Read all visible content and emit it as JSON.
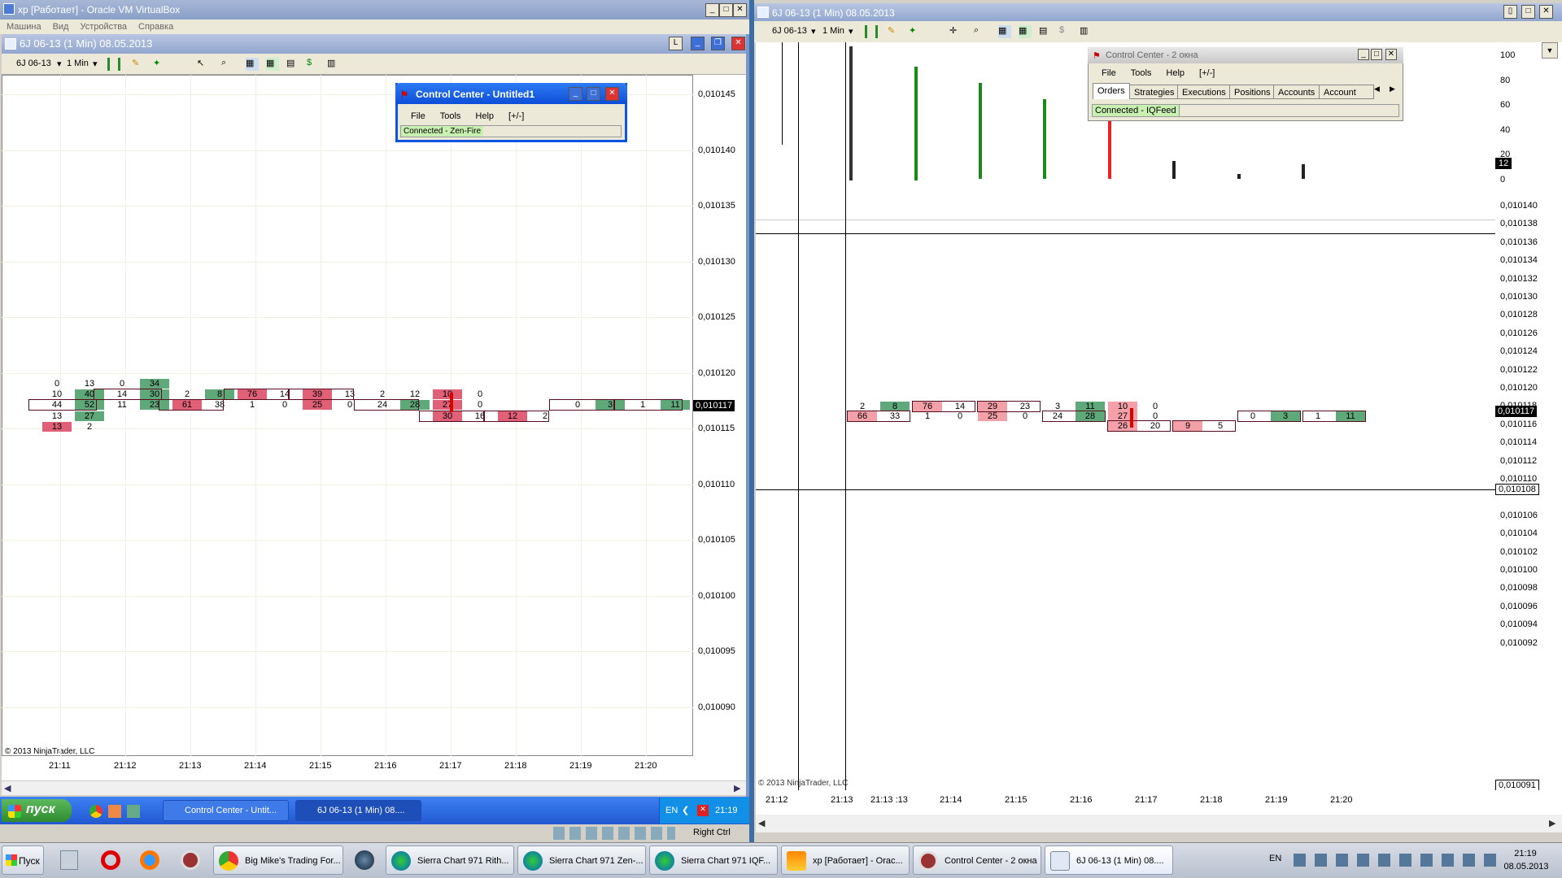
{
  "vbox": {
    "title": "xp [Работает] - Oracle VM VirtualBox",
    "menu": [
      "Машина",
      "Вид",
      "Устройства",
      "Справка"
    ]
  },
  "left_chart": {
    "title": "6J 06-13 (1 Min)  08.05.2013",
    "instrument": "6J 06-13",
    "interval": "1 Min",
    "copyright": "© 2013 NinjaTrader, LLC",
    "price_marker": "0,010117",
    "y_labels": [
      "0,010145",
      "0,010140",
      "0,010135",
      "0,010130",
      "0,010125",
      "0,010120",
      "0,010115",
      "0,010110",
      "0,010105",
      "0,010100",
      "0,010095",
      "0,010090"
    ],
    "x_labels": [
      "21:11",
      "21:12",
      "21:13",
      "21:14",
      "21:15",
      "21:16",
      "21:17",
      "21:18",
      "21:19",
      "21:20"
    ]
  },
  "cc1": {
    "title": "Control Center - Untitled1",
    "menu": [
      "File",
      "Tools",
      "Help",
      "[+/-]"
    ],
    "status": "Connected - Zen-Fire"
  },
  "xp_taskbar": {
    "start": "пуск",
    "tasks": [
      "Control Center - Untit...",
      "6J 06-13 (1 Min)  08...."
    ],
    "lang": "EN",
    "clock": "21:19",
    "host_key": "Right Ctrl"
  },
  "right_chart": {
    "title": "6J 06-13 (1 Min)  08.05.2013",
    "instrument": "6J 06-13",
    "interval": "1 Min",
    "copyright": "© 2013 NinjaTrader, LLC",
    "price_marker": "0,010117",
    "cross_marker": "0,010108",
    "bottom_marker": "0,010091",
    "vol_marker": "12",
    "vol_labels": [
      "100",
      "80",
      "60",
      "40",
      "20",
      "0"
    ],
    "y_labels": [
      "0,010140",
      "0,010138",
      "0,010136",
      "0,010134",
      "0,010132",
      "0,010130",
      "0,010128",
      "0,010126",
      "0,010124",
      "0,010122",
      "0,010120",
      "0,010118",
      "0,010116",
      "0,010114",
      "0,010112",
      "0,010110",
      "0,010106",
      "0,010104",
      "0,010102",
      "0,010100",
      "0,010098",
      "0,010096",
      "0,010094",
      "0,010092"
    ],
    "x_labels": [
      "21:12",
      "21:13",
      "21:13 :13",
      "21:14",
      "21:15",
      "21:16",
      "21:17",
      "21:18",
      "21:19",
      "21:20"
    ]
  },
  "cc2": {
    "title": "Control Center - 2 окна",
    "menu": [
      "File",
      "Tools",
      "Help",
      "[+/-]"
    ],
    "tabs": [
      "Orders",
      "Strategies",
      "Executions",
      "Positions",
      "Accounts",
      "Account Per"
    ],
    "status": "Connected - IQFeed"
  },
  "win7_taskbar": {
    "start": "Пуск",
    "tasks": [
      "Big Mike's Trading For...",
      "Sierra Chart 971 Rith...",
      "Sierra Chart 971 Zen-...",
      "Sierra Chart 971 IQF...",
      "xp [Работает] - Orac...",
      "Control Center - 2 окна",
      "6J 06-13 (1 Min)  08...."
    ],
    "lang": "EN",
    "time": "21:19",
    "date": "08.05.2013"
  },
  "colors": {
    "green": "#5aa870",
    "red": "#e0506a",
    "pink": "#f4a0a8",
    "boxborder": "#5a0c1e"
  }
}
